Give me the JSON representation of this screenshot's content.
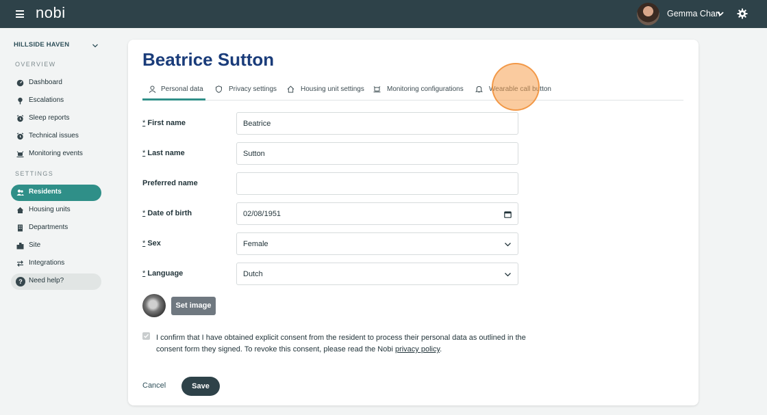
{
  "app": {
    "logo_text": "nobi"
  },
  "user": {
    "name": "Gemma Chan"
  },
  "sidebar": {
    "site_name": "HILLSIDE HAVEN",
    "overview_label": "OVERVIEW",
    "settings_label": "SETTINGS",
    "overview_items": [
      {
        "label": "Dashboard",
        "icon": "dashboard-icon"
      },
      {
        "label": "Escalations",
        "icon": "pin-icon"
      },
      {
        "label": "Sleep reports",
        "icon": "alarm-clock-icon"
      },
      {
        "label": "Technical issues",
        "icon": "alarm-clock-icon"
      },
      {
        "label": "Monitoring events",
        "icon": "monitor-icon"
      }
    ],
    "settings_items": [
      {
        "label": "Residents",
        "icon": "users-icon",
        "active": true
      },
      {
        "label": "Housing units",
        "icon": "home-icon"
      },
      {
        "label": "Departments",
        "icon": "building-icon"
      },
      {
        "label": "Site",
        "icon": "city-icon"
      },
      {
        "label": "Integrations",
        "icon": "swap-icon"
      }
    ],
    "help_label": "Need help?"
  },
  "main": {
    "title": "Beatrice Sutton",
    "tabs": [
      {
        "label": "Personal data",
        "icon": "person-icon",
        "active": true
      },
      {
        "label": "Privacy settings",
        "icon": "shield-icon"
      },
      {
        "label": "Housing unit settings",
        "icon": "home-icon"
      },
      {
        "label": "Monitoring configurations",
        "icon": "monitor-icon"
      },
      {
        "label": "Wearable call button",
        "icon": "bell-icon"
      }
    ],
    "required_marker": "*",
    "fields": {
      "first_name": {
        "label": "First name",
        "value": "Beatrice",
        "required": true
      },
      "last_name": {
        "label": "Last name",
        "value": "Sutton",
        "required": true
      },
      "preferred_name": {
        "label": "Preferred name",
        "value": "",
        "required": false
      },
      "date_of_birth": {
        "label": "Date of birth",
        "value": "02/08/1951",
        "required": true
      },
      "sex": {
        "label": "Sex",
        "value": "Female",
        "required": true
      },
      "language": {
        "label": "Language",
        "value": "Dutch",
        "required": true
      }
    },
    "set_image_label": "Set image",
    "consent": {
      "text_before": "I confirm that I have obtained explicit consent from the resident to process their personal data as outlined in the consent form they signed. To revoke this consent, please read the Nobi ",
      "link_text": "privacy policy",
      "text_after": ".",
      "checked": true
    },
    "cancel_label": "Cancel",
    "save_label": "Save"
  },
  "colors": {
    "topbar": "#2e4249",
    "accent": "#2f8f88",
    "title": "#1a3c7a",
    "cursor_highlight": "#f5a050"
  }
}
